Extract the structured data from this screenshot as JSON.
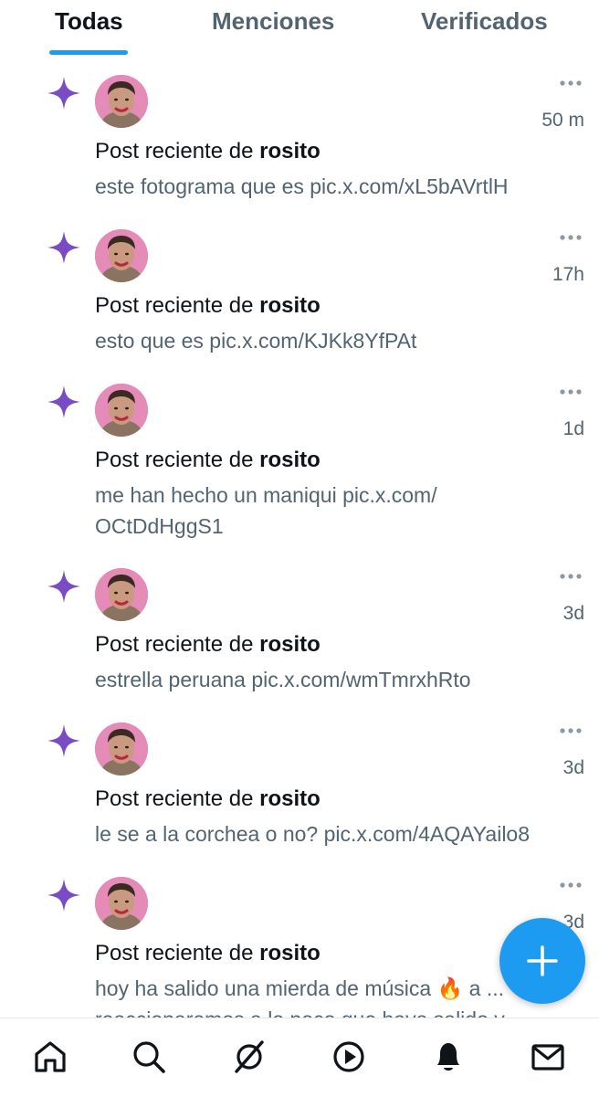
{
  "tabs": [
    {
      "label": "Todas",
      "active": true
    },
    {
      "label": "Menciones",
      "active": false
    },
    {
      "label": "Verificados",
      "active": false
    }
  ],
  "accent_color": "#1d9bf0",
  "spark_color": "#794bc4",
  "notifications": [
    {
      "prefix": "Post reciente de",
      "user": "rosito",
      "time": "50 m",
      "text": "este fotograma que es pic.x.com/xL5bAVrtlH"
    },
    {
      "prefix": "Post reciente de",
      "user": "rosito",
      "time": "17h",
      "text": "esto que es pic.x.com/KJKk8YfPAt"
    },
    {
      "prefix": "Post reciente de",
      "user": "rosito",
      "time": "1d",
      "text": "me han hecho un maniqui pic.x.com/ OCtDdHggS1"
    },
    {
      "prefix": "Post reciente de",
      "user": "rosito",
      "time": "3d",
      "text": "estrella peruana pic.x.com/wmTmrxhRto"
    },
    {
      "prefix": "Post reciente de",
      "user": "rosito",
      "time": "3d",
      "text": "le se a la corchea o no? pic.x.com/4AQAYailo8"
    },
    {
      "prefix": "Post reciente de",
      "user": "rosito",
      "time": "3d",
      "text": "hoy ha salido una mierda de música 🔥 a ... reaccionaremos a lo poco que haya salido y"
    }
  ],
  "nav": [
    "home-icon",
    "search-icon",
    "grok-icon",
    "play-icon",
    "bell-icon",
    "mail-icon"
  ],
  "fab_icon": "plus-icon"
}
